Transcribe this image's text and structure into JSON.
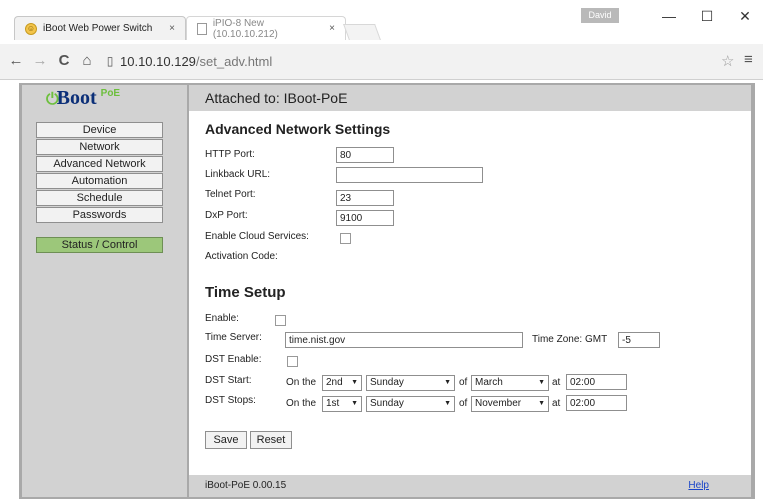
{
  "browser": {
    "tabs": [
      {
        "label": "iBoot Web Power Switch",
        "close": "×"
      },
      {
        "label": "iPIO-8 New (10.10.10.212)",
        "close": "×"
      }
    ],
    "user": "David",
    "url_host": "10.10.10.129",
    "url_path": "/set_adv.html"
  },
  "sidebar": {
    "logo_text": "Boot",
    "logo_badge": "PoE",
    "items": [
      "Device",
      "Network",
      "Advanced Network",
      "Automation",
      "Schedule",
      "Passwords"
    ],
    "status_button": "Status / Control"
  },
  "header": {
    "attached": "Attached to: IBoot-PoE"
  },
  "network": {
    "title": "Advanced Network Settings",
    "http_port_label": "HTTP Port:",
    "http_port": "80",
    "linkback_label": "Linkback URL:",
    "linkback": "",
    "telnet_label": "Telnet Port:",
    "telnet": "23",
    "dxp_label": "DxP Port:",
    "dxp": "9100",
    "cloud_label": "Enable Cloud Services:",
    "activation_label": "Activation Code:"
  },
  "time": {
    "title": "Time Setup",
    "enable_label": "Enable:",
    "server_label": "Time Server:",
    "server": "time.nist.gov",
    "tz_label": "Time Zone: GMT",
    "tz": "-5",
    "dst_enable_label": "DST Enable:",
    "dst_start_label": "DST Start:",
    "dst_stop_label": "DST Stops:",
    "on_the": "On the",
    "of": "of",
    "at": "at",
    "start": {
      "week": "2nd",
      "day": "Sunday",
      "month": "March",
      "time": "02:00"
    },
    "stop": {
      "week": "1st",
      "day": "Sunday",
      "month": "November",
      "time": "02:00"
    }
  },
  "buttons": {
    "save": "Save",
    "reset": "Reset"
  },
  "footer": {
    "version": "iBoot-PoE 0.00.15",
    "help": "Help"
  }
}
